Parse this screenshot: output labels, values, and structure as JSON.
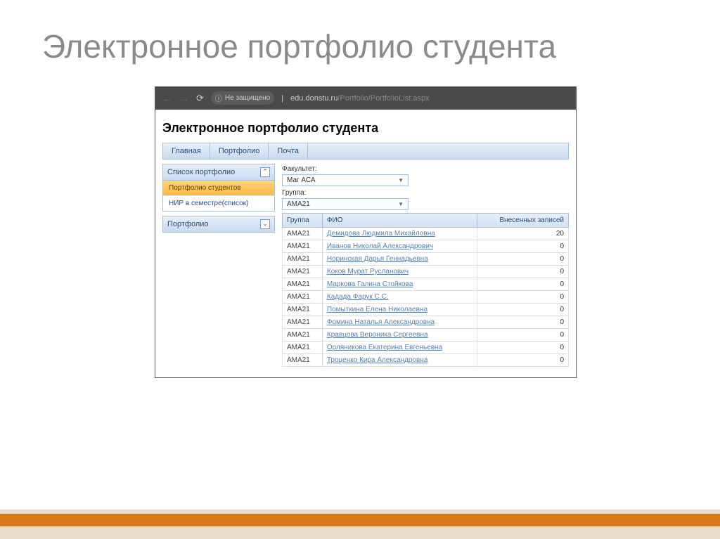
{
  "slide": {
    "title": "Электронное портфолио студента"
  },
  "browser": {
    "security_label": "Не защищено",
    "url_host": "edu.donstu.ru",
    "url_path": "/Portfolio/PortfolioList.aspx"
  },
  "page": {
    "heading": "Электронное портфолио студента",
    "topnav": {
      "home": "Главная",
      "portfolio": "Портфолио",
      "mail": "Почта"
    },
    "sidebar": {
      "panel1": {
        "header": "Список портфолио",
        "item_students": "Портфолио студентов",
        "item_nir": "НИР в семестре(список)"
      },
      "panel2": {
        "header": "Портфолио"
      }
    },
    "filters": {
      "faculty_label": "Факультет:",
      "faculty_value": "Маг АСА",
      "group_label": "Группа:",
      "group_value": "АМА21"
    },
    "table": {
      "col_group": "Группа",
      "col_fio": "ФИО",
      "col_count": "Внесенных записей",
      "rows": [
        {
          "group": "АМА21",
          "fio": "Демидова Людмила Михайловна",
          "count": "20"
        },
        {
          "group": "АМА21",
          "fio": "Иванов Николай Александрович",
          "count": "0"
        },
        {
          "group": "АМА21",
          "fio": "Норинская Дарья Геннадьевна",
          "count": "0"
        },
        {
          "group": "АМА21",
          "fio": "Коков Мурат Русланович",
          "count": "0"
        },
        {
          "group": "АМА21",
          "fio": "Маркова Галина Стойкова",
          "count": "0"
        },
        {
          "group": "АМА21",
          "fio": "Кадада Фарук С.С.",
          "count": "0"
        },
        {
          "group": "АМА21",
          "fio": "Помыткина Елена Николаевна",
          "count": "0"
        },
        {
          "group": "АМА21",
          "fio": "Фомина Наталья Александровна",
          "count": "0"
        },
        {
          "group": "АМА21",
          "fio": "Кравцова Вероника Сергеевна",
          "count": "0"
        },
        {
          "group": "АМА21",
          "fio": "Орляникова Екатерина Евгеньевна",
          "count": "0"
        },
        {
          "group": "АМА21",
          "fio": "Троценко Кира Александровна",
          "count": "0"
        }
      ]
    }
  }
}
